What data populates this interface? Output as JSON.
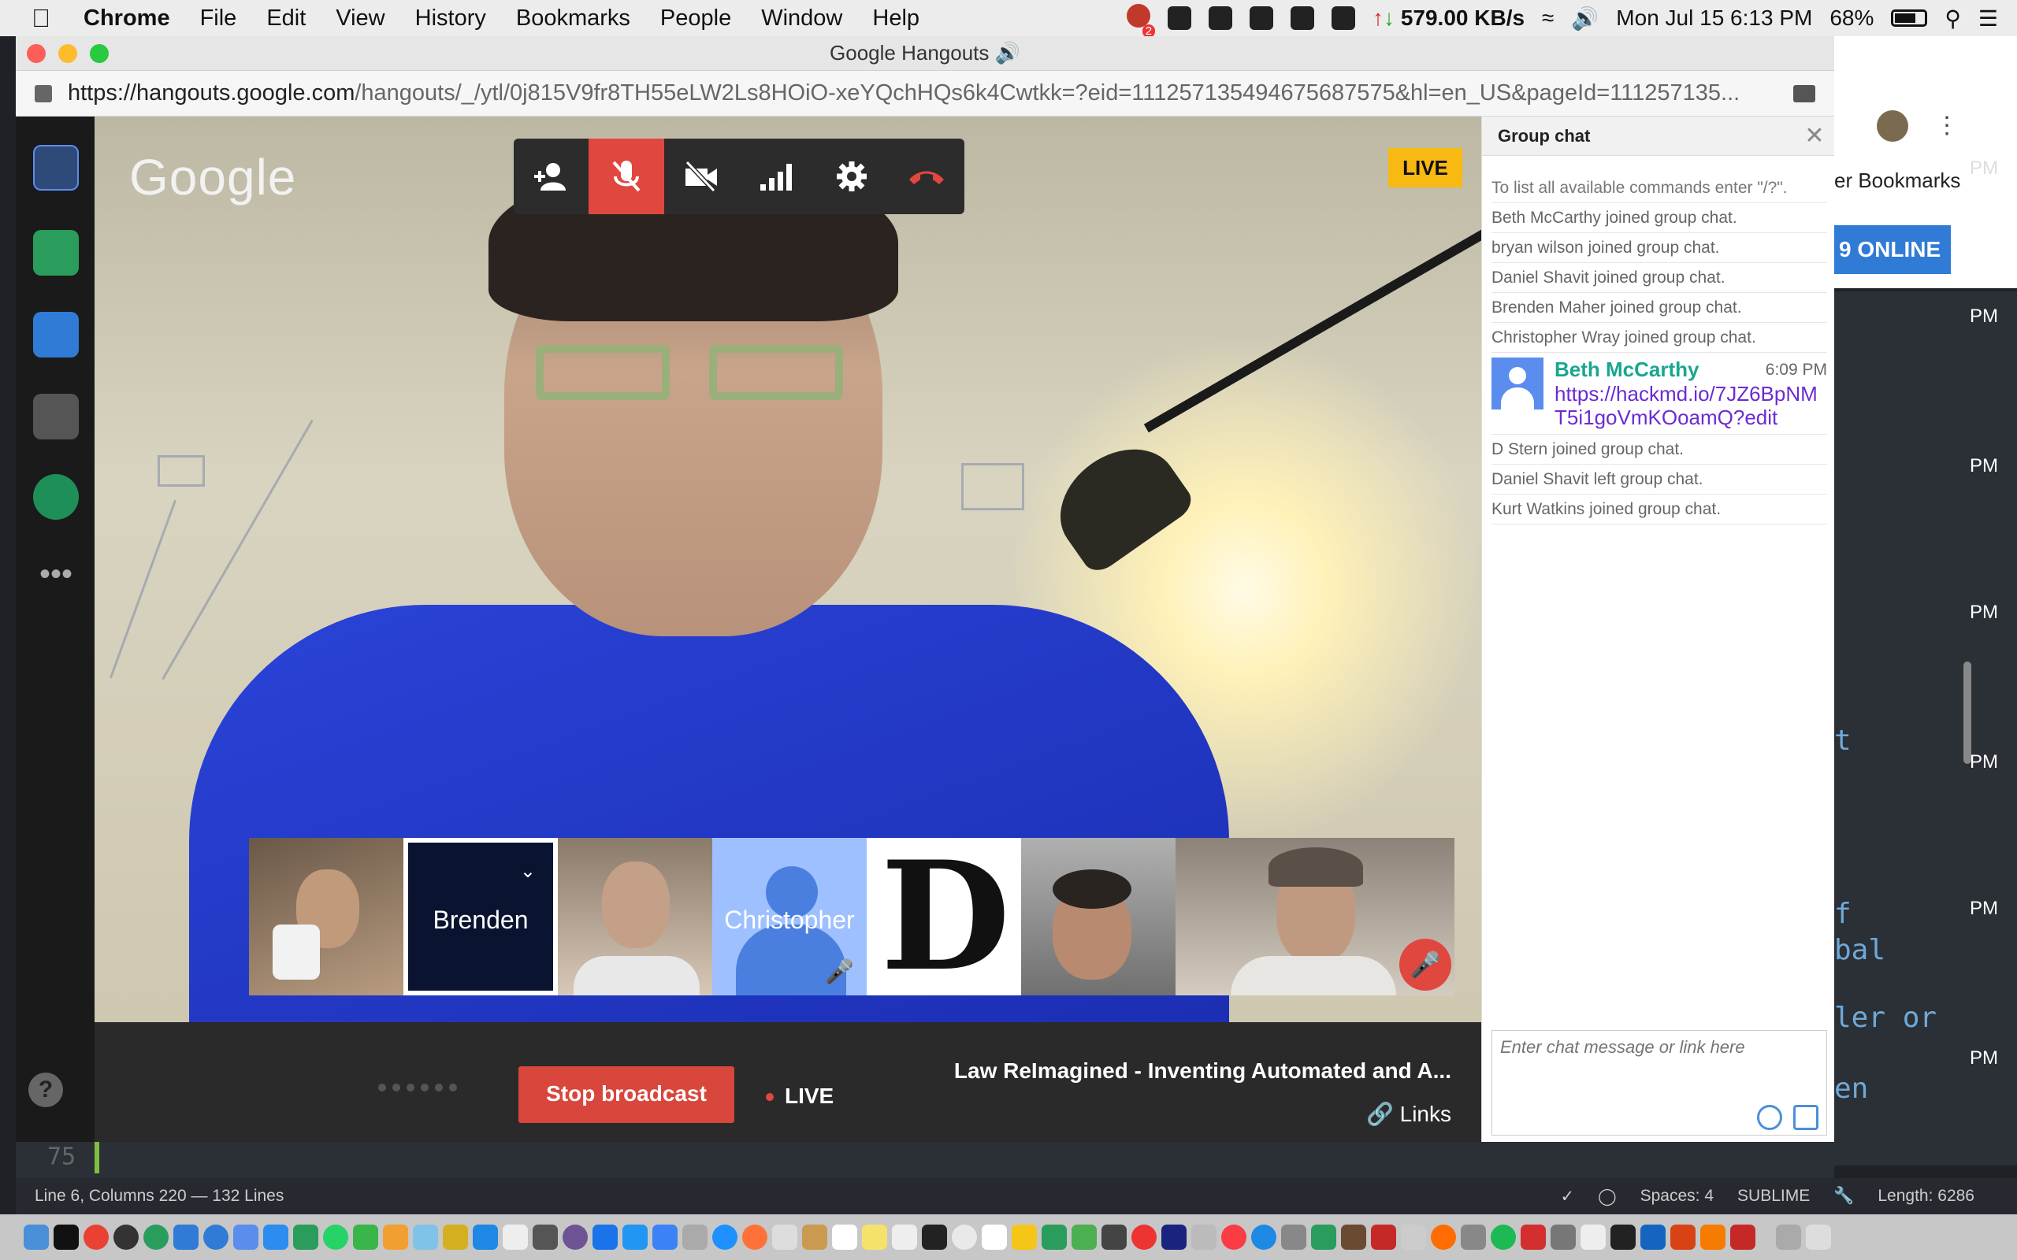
{
  "menubar": {
    "apple": "",
    "app": "Chrome",
    "items": [
      "File",
      "Edit",
      "View",
      "History",
      "Bookmarks",
      "People",
      "Window",
      "Help"
    ],
    "network_speed": "579.00 KB/s",
    "clock": "Mon Jul 15  6:13 PM",
    "battery": "68%",
    "badge_count": "2"
  },
  "window": {
    "title": "Google Hangouts 🔊",
    "url_host": "https://hangouts.google.com",
    "url_path": "/hangouts/_/ytl/0j815V9fr8TH55eLW2Ls8HOiO-xeYQchHQs6k4Cwtkk=?eid=111257135494675687575&hl=en_US&pageId=111257135..."
  },
  "hangout": {
    "logo": "Google",
    "live_badge": "LIVE",
    "participants": [
      {
        "name": "",
        "muted": false
      },
      {
        "name": "Brenden",
        "selected": true
      },
      {
        "name": ""
      },
      {
        "name": "Christopher",
        "muted": true
      },
      {
        "name": "",
        "muted": true
      },
      {
        "name": ""
      },
      {
        "name": "",
        "muted": true
      }
    ],
    "stop_broadcast": "Stop broadcast",
    "live_label": "LIVE",
    "broadcast_title": "Law ReImagined - Inventing Automated and A...",
    "links_label": "Links"
  },
  "chat": {
    "title": "Group chat",
    "close": "✕",
    "messages": [
      "To list all available commands enter \"/?\".",
      "Beth McCarthy joined group chat.",
      "bryan wilson joined group chat.",
      "Daniel Shavit joined group chat.",
      "Brenden Maher joined group chat.",
      "Christopher Wray joined group chat.",
      "D Stern joined group chat.",
      "Daniel Shavit left group chat.",
      "Kurt Watkins joined group chat."
    ],
    "user_message": {
      "author": "Beth McCarthy",
      "time": "6:09 PM",
      "link": "https://hackmd.io/7JZ6BpNMT5i1goVmKOoamQ?edit"
    },
    "input_placeholder": "Enter chat message or link here"
  },
  "background": {
    "bookmarks_fragment": "er Bookmarks",
    "online_button": "9 ONLINE",
    "pm_labels": [
      "PM",
      "PM",
      "PM",
      "PM",
      "PM",
      "PM",
      "PM"
    ],
    "code_fragments": [
      "t",
      "f",
      "bal",
      "ler or",
      "en"
    ],
    "line_number": "75"
  },
  "statusbar": {
    "left": "Line 6, Columns 220 — 132 Lines",
    "spaces": "Spaces: 4",
    "syntax": "SUBLIME",
    "length": "Length: 6286"
  },
  "colors": {
    "accent_red": "#e0473f",
    "live_yellow": "#f7b912",
    "chat_author": "#1aa68f",
    "chat_link": "#6b2bd1",
    "online_blue": "#2f7bd6"
  }
}
